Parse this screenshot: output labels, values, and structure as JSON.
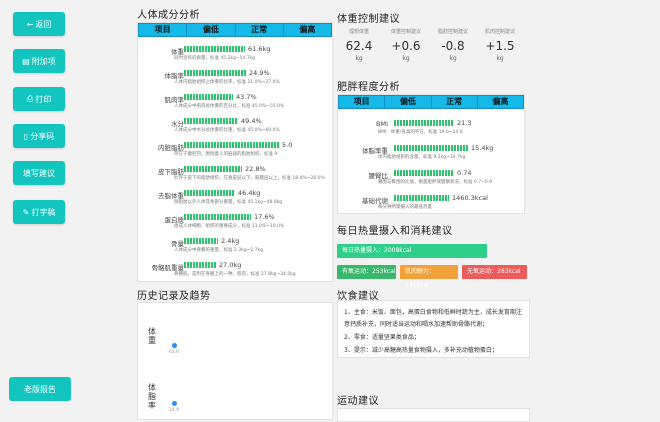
{
  "sidebar": {
    "buttons": [
      {
        "icon": "←",
        "label": "返回"
      },
      {
        "icon": "▤",
        "label": "附加项"
      },
      {
        "icon": "⎙",
        "label": "打印"
      },
      {
        "icon": "▯",
        "label": "分享码"
      },
      {
        "icon": "",
        "label": "填写建议"
      },
      {
        "icon": "✎",
        "label": "打字稿"
      }
    ],
    "bottom_label": "老版报告"
  },
  "composition": {
    "title": "人体成分分析",
    "headers": [
      "项目",
      "偏低",
      "正常",
      "偏高"
    ],
    "rows": [
      {
        "label": "体重",
        "value": "61.6kg",
        "level": 0.46,
        "desc": "同时含有的质量，标准 45.2kg~54.7kg"
      },
      {
        "label": "体脂率",
        "value": "24.9%",
        "level": 0.47,
        "desc": "人体内脂肪组织占体重的比率，标准 21.0%~27.0%"
      },
      {
        "label": "肌肉率",
        "value": "43.7%",
        "level": 0.37,
        "desc": "人体成分中肌肉总体重的百分比，标准 45.0%~55.0%"
      },
      {
        "label": "水分",
        "value": "49.4%",
        "level": 0.41,
        "desc": "人体成分中水分总体重的比重，标准 45.0%~60.0%"
      },
      {
        "label": "内脏脂肪",
        "value": "5.0",
        "level": 0.72,
        "desc": "存在于腹腔内，围绕着人的脏器的脂肪组织，标准 9"
      },
      {
        "label": "皮下脂肪",
        "value": "22.8%",
        "level": 0.44,
        "desc": "贮存于皮下的脂肪组织，在真皮层以下，筋膜层以上，标准 18.0%~26.0%"
      },
      {
        "label": "去脂体重",
        "value": "46.4kg",
        "level": 0.39,
        "desc": "除脂肪以外人体其余部分重量，标准 45.1kg~48.8kg"
      },
      {
        "label": "蛋白质",
        "value": "17.6%",
        "level": 0.51,
        "desc": "组成人体细胞、组织的重要成分，标准 11.0%~19.0%"
      },
      {
        "label": "骨量",
        "value": "2.4kg",
        "level": 0.26,
        "desc": "人体成分中骨骼的重量，标准 2.3kg~2.7kg"
      },
      {
        "label": "骨骼肌重量",
        "value": "27.0kg",
        "level": 0.24,
        "desc": "骨骼肌，是附在骨骼上的一种，肌肉，标准 27.8kg~34.0kg"
      }
    ]
  },
  "control": {
    "title": "体重控制建议",
    "items": [
      {
        "label": "理想体重",
        "value": "62.4",
        "unit": "kg"
      },
      {
        "label": "体重控制建议",
        "value": "+0.6",
        "unit": "kg"
      },
      {
        "label": "脂肪控制建议",
        "value": "-0.8",
        "unit": "kg"
      },
      {
        "label": "肌肉控制建议",
        "value": "+1.5",
        "unit": "kg"
      }
    ]
  },
  "obesity": {
    "title": "肥胖程度分析",
    "headers": [
      "项目",
      "偏低",
      "正常",
      "偏高"
    ],
    "rows": [
      {
        "label": "BMI",
        "value": "21.3",
        "level": 0.5,
        "desc": "BMI：体重/身高的平方，标准 19.0~24.0"
      },
      {
        "label": "体脂率重",
        "value": "15.4kg",
        "level": 0.62,
        "desc": "体内脂肪组织的含量，标准 9.2kg~14.7kg"
      },
      {
        "label": "腰臀比",
        "value": "0.74",
        "level": 0.5,
        "desc": "腰围与臀围的比值，衡量肥胖或健康状况，标准 0.7~0.9"
      },
      {
        "label": "基础代谢",
        "value": "1460.3kcal",
        "level": 0.46,
        "desc": "每分钟所需摄入的最低热量"
      }
    ]
  },
  "energy": {
    "title": "每日热量摄入和消耗建议",
    "intake": "每日热量摄入：2008kcal",
    "items": [
      "有氧运动：253kcal",
      "肌肉耐力：131kcal",
      "无氧运动：263kcal"
    ],
    "colors": {
      "intake": "#2ecf8a",
      "aerobic": "#38b86a",
      "endurance": "#f0a13a",
      "anaerobic": "#ec5c5c"
    }
  },
  "history": {
    "title": "历史记录及趋势",
    "items": [
      {
        "label": "体重",
        "value": "61.6"
      },
      {
        "label": "体脂率",
        "value": "24.9"
      }
    ]
  },
  "diet": {
    "title": "饮食建议",
    "lines": [
      "1、主食：米饭、面包，高蛋白食物和低鲜时蔬为主，成长发育期注意钙质补充，同时适当运动和喝水加速帮助骨骼代谢；",
      "2、零食：适量坚果类食品；",
      "3、提示：减少高糖高热量食物摄入，多补充动植物蛋白；"
    ]
  },
  "exercise": {
    "title": "运动建议"
  }
}
